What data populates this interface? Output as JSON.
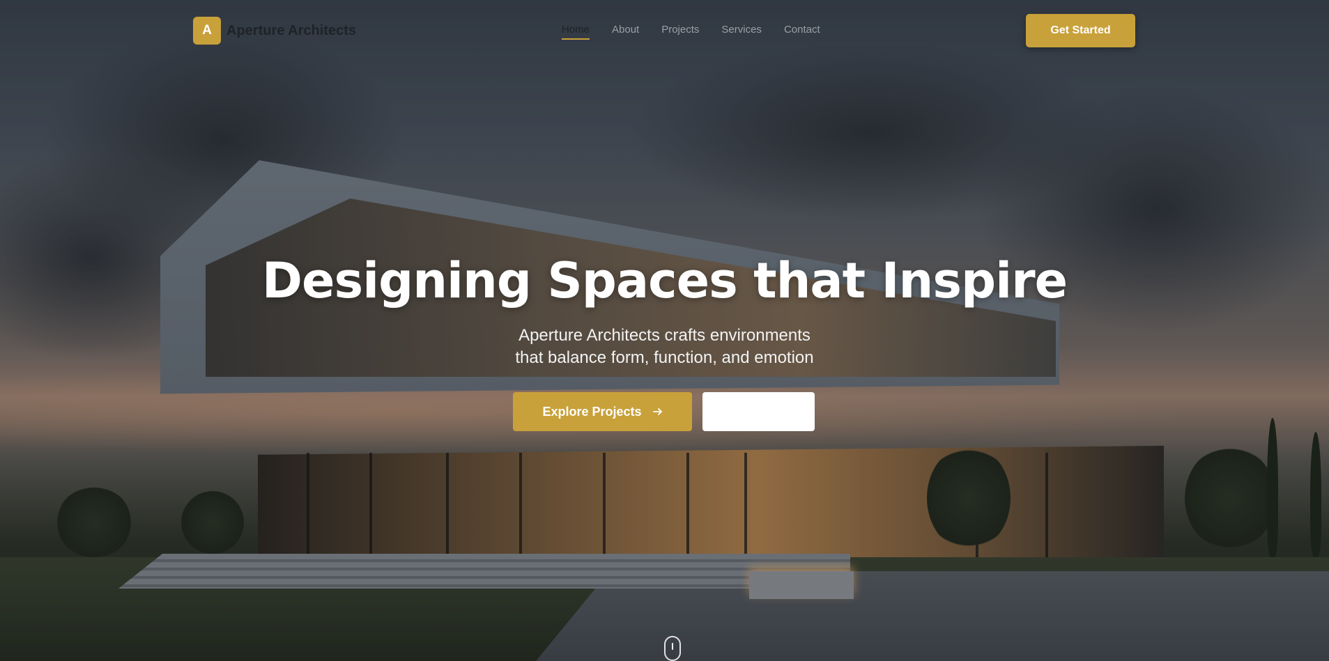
{
  "brand": {
    "logo_letter": "A",
    "name": "Aperture Architects",
    "accent_color": "#c9a13a"
  },
  "nav": {
    "links": [
      {
        "label": "Home",
        "active": true
      },
      {
        "label": "About",
        "active": false
      },
      {
        "label": "Projects",
        "active": false
      },
      {
        "label": "Services",
        "active": false
      },
      {
        "label": "Contact",
        "active": false
      }
    ],
    "cta_label": "Get Started"
  },
  "hero": {
    "headline": "Designing Spaces that Inspire",
    "subtitle_line1": "Aperture Architects crafts environments",
    "subtitle_line2": "that balance form, function, and emotion",
    "primary_button": {
      "label": "Explore Projects",
      "icon": "arrow-right-icon"
    },
    "secondary_button": {
      "label": ""
    },
    "background": "modern-house-at-dusk",
    "scroll_icon": "mouse-scroll-icon"
  }
}
